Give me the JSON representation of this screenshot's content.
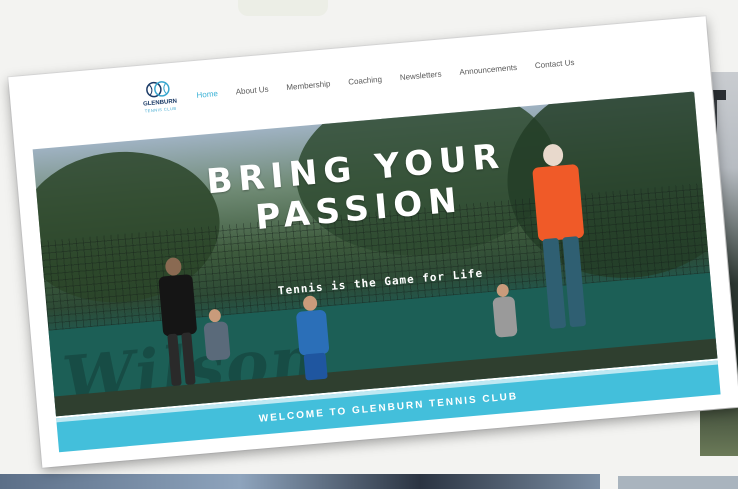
{
  "club": {
    "logo_name": "GLENBURN",
    "logo_sub": "TENNIS CLUB"
  },
  "nav": {
    "items": [
      {
        "label": "Home",
        "active": true
      },
      {
        "label": "About Us",
        "active": false
      },
      {
        "label": "Membership",
        "active": false
      },
      {
        "label": "Coaching",
        "active": false
      },
      {
        "label": "Newsletters",
        "active": false
      },
      {
        "label": "Announcements",
        "active": false
      },
      {
        "label": "Contact Us",
        "active": false
      }
    ]
  },
  "hero": {
    "title_line1": "BRING YOUR",
    "title_line2": "PASSION",
    "subtitle": "Tennis is the Game for Life",
    "banner_brand": "Wilson"
  },
  "welcome": {
    "text": "WELCOME TO GLENBURN TENNIS CLUB"
  },
  "colors": {
    "accent": "#43bfdb",
    "nav_active": "#3bb2d6",
    "shirt_orange": "#f05a28"
  },
  "icons": {
    "logo": "tennis-ball-logo-icon"
  }
}
